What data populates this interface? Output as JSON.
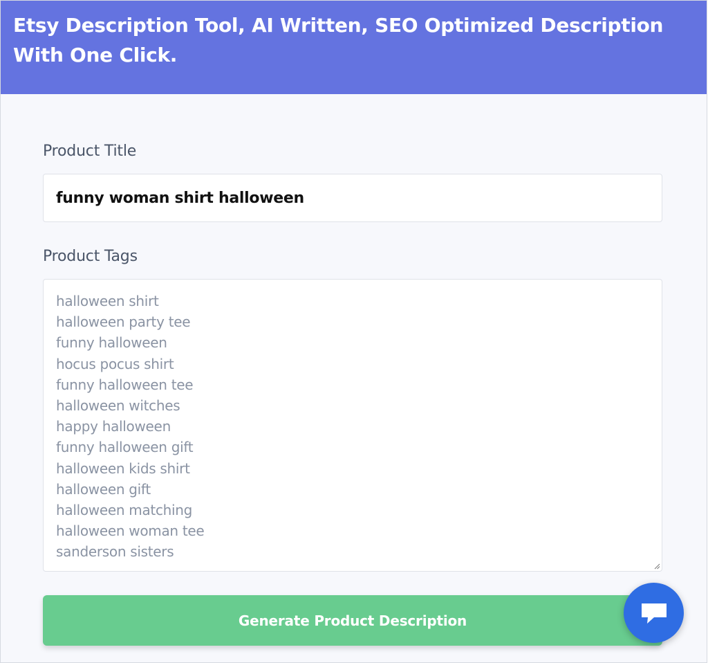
{
  "header": {
    "title": "Etsy Description Tool, AI Written, SEO Optimized Description With One Click."
  },
  "form": {
    "title_label": "Product Title",
    "title_value": "funny woman shirt halloween",
    "tags_label": "Product Tags",
    "tags": [
      "halloween shirt",
      "halloween party tee",
      "funny halloween",
      "hocus pocus shirt",
      "funny halloween tee",
      "halloween witches",
      "happy halloween",
      "funny halloween gift",
      "halloween kids shirt",
      "halloween gift",
      "halloween matching",
      "halloween woman tee",
      "sanderson sisters"
    ],
    "submit_label": "Generate Product Description"
  },
  "chat": {
    "icon": "chat-bubble-icon"
  },
  "colors": {
    "header_bg": "#6473e0",
    "button_bg": "#68cc8f",
    "chat_bg": "#2f6de3",
    "page_bg": "#f7f8fc"
  }
}
